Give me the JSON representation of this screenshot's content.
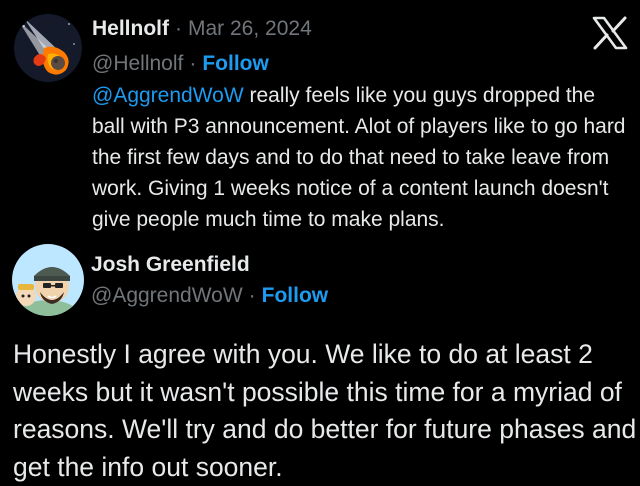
{
  "tweet": {
    "author": {
      "display_name": "Hellnolf",
      "handle": "@Hellnolf",
      "avatar_icon": "meteor-avatar-icon"
    },
    "date": "Mar 26, 2024",
    "separator": "·",
    "follow_label": "Follow",
    "mention": "@AggrendWoW",
    "text_rest": " really feels like you guys dropped the ball with P3 announcement. Alot of players like to go hard the first few days and to do that need to take leave from work. Giving 1 weeks notice of a content launch doesn't give people much time to make plans."
  },
  "reply": {
    "author": {
      "display_name": "Josh Greenfield",
      "handle": "@AggrendWoW",
      "avatar_icon": "cartoon-character-avatar-icon"
    },
    "separator": "·",
    "follow_label": "Follow",
    "text": "Honestly I agree with you. We like to do at least 2 weeks but it wasn't possible this time for a myriad of reasons. We'll try and do better for future phases and get the info out sooner."
  },
  "brand": {
    "logo_icon": "x-logo-icon"
  },
  "colors": {
    "background": "#000000",
    "text": "#e7e9ea",
    "muted": "#71767b",
    "accent": "#1d9bf0"
  }
}
